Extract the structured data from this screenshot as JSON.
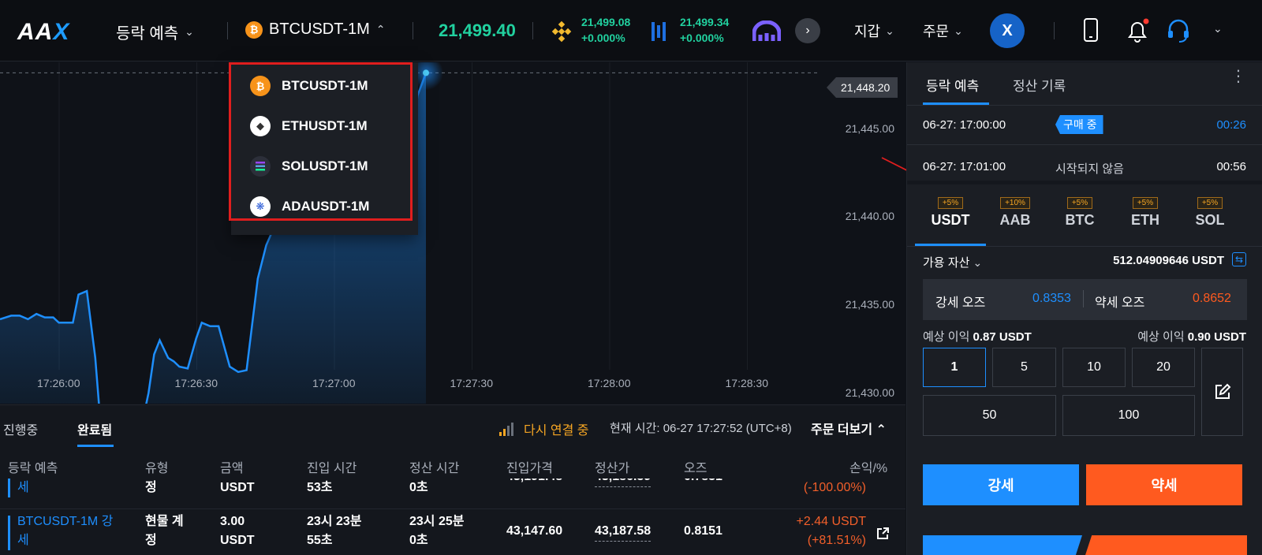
{
  "header": {
    "logo_main": "AA",
    "logo_accent": "X",
    "prediction_menu": "등락 예측",
    "pair_selected": "BTCUSDT-1M",
    "price": "21,499.40",
    "binance_price": "21,499.08",
    "binance_change": "+0.000%",
    "ticker2_price": "21,499.34",
    "ticker2_change": "+0.000%",
    "wallet": "지갑",
    "orders": "주문",
    "avatar": "X"
  },
  "dropdown": {
    "items": [
      {
        "label": "BTCUSDT-1M",
        "icon": "bitcoin-icon"
      },
      {
        "label": "ETHUSDT-1M",
        "icon": "ethereum-icon"
      },
      {
        "label": "SOLUSDT-1M",
        "icon": "solana-icon"
      },
      {
        "label": "ADAUSDT-1M",
        "icon": "cardano-icon"
      }
    ]
  },
  "chart_data": {
    "type": "area",
    "current_price_label": "21,448.20",
    "y_ticks": [
      "21,445.00",
      "21,440.00",
      "21,435.00",
      "21,430.00"
    ],
    "x_ticks": [
      "17:26:00",
      "17:26:30",
      "17:27:00",
      "17:27:30",
      "17:28:00",
      "17:28:30"
    ],
    "ylim": [
      21429.4,
      21448.8
    ],
    "x": [
      0,
      4,
      7,
      10,
      13,
      16,
      19,
      21,
      24,
      26,
      28,
      31,
      34,
      36,
      38,
      40,
      43,
      46,
      49,
      51,
      53,
      55,
      57,
      60,
      62,
      64,
      67,
      70,
      72,
      75,
      78,
      82,
      85,
      88,
      92,
      95,
      98,
      101,
      104,
      107,
      110,
      113,
      116,
      119,
      122,
      125,
      128,
      131,
      134,
      137,
      140,
      143,
      146,
      149,
      152
    ],
    "values": [
      21434.2,
      21434.4,
      21434.4,
      21434.2,
      21434.5,
      21434.3,
      21434.3,
      21434.0,
      21434.0,
      21434.0,
      21435.6,
      21435.8,
      21432.0,
      21428.0,
      21428.9,
      21428.8,
      21428.4,
      21428.4,
      21428.4,
      21428.5,
      21430.0,
      21432.2,
      21433.0,
      21432.0,
      21431.8,
      21431.5,
      21431.4,
      21433.1,
      21434.0,
      21433.8,
      21433.8,
      21431.5,
      21431.2,
      21431.3,
      21436.5,
      21438.4,
      21439.5,
      21440.5,
      21441.8,
      21442.6,
      21441.8,
      21441.0,
      21441.6,
      21441.0,
      21440.6,
      21440.5,
      21441.2,
      21442.5,
      21443.5,
      21441.5,
      21441.3,
      21441.4,
      21443.3,
      21446.9,
      21448.2
    ]
  },
  "bottom": {
    "tab_open": "진행중",
    "tab_done": "완료됨",
    "reconnect": "다시 연결 중",
    "current_time": "현재 시간: 06-27 17:27:52 (UTC+8)",
    "more_orders": "주문 더보기",
    "columns": [
      "등락 예측",
      "유형",
      "금액",
      "진입 시간",
      "정산 시간",
      "진입가격",
      "정산가",
      "오즈",
      "손익/%"
    ],
    "row1": {
      "pred": "세",
      "type": "정",
      "amount": "USDT",
      "entry_time": "53초",
      "settle_time": "0초",
      "entry_price": "43,191.48",
      "settle_price": "43,186.59",
      "odds": "0.7851",
      "pnl": "(-100.00%)"
    },
    "row2": {
      "pred1": "BTCUSDT-1M 강",
      "pred2": "세",
      "type1": "현물 계",
      "type2": "정",
      "amount1": "3.00",
      "amount2": "USDT",
      "entry1": "23시 23분",
      "entry2": "55초",
      "settle1": "23시 25분",
      "settle2": "0초",
      "entry_price": "43,147.60",
      "settle_price": "43,187.58",
      "odds": "0.8151",
      "pnl1": "+2.44 USDT",
      "pnl2": "(+81.51%)"
    }
  },
  "right": {
    "tab_predict": "등락 예측",
    "tab_history": "정산 기록",
    "round1_time": "06-27: 17:00:00",
    "round1_status": "구매 중",
    "round1_timer": "00:26",
    "round2_time": "06-27: 17:01:00",
    "round2_status": "시작되지 않음",
    "round2_timer": "00:56",
    "assets": [
      {
        "name": "USDT",
        "badge": "+5%"
      },
      {
        "name": "AAB",
        "badge": "+10%"
      },
      {
        "name": "BTC",
        "badge": "+5%"
      },
      {
        "name": "ETH",
        "badge": "+5%"
      },
      {
        "name": "SOL",
        "badge": "+5%"
      }
    ],
    "available_label": "가용 자산",
    "available_value": "512.04909646 USDT",
    "odds_up_label": "강세 오즈",
    "odds_up": "0.8353",
    "odds_down_label": "약세 오즈",
    "odds_down": "0.8652",
    "profit_up_label": "예상 이익",
    "profit_up": "0.87 USDT",
    "profit_down_label": "예상 이익",
    "profit_down": "0.90 USDT",
    "amounts": [
      "1",
      "5",
      "10",
      "20",
      "50",
      "100"
    ],
    "up_button": "강세",
    "down_button": "약세"
  },
  "colors": {
    "accent": "#1e8fff",
    "up": "#21d19f",
    "down": "#ff5a1f",
    "warning": "#f6a623",
    "annotation": "#e01e1e"
  }
}
